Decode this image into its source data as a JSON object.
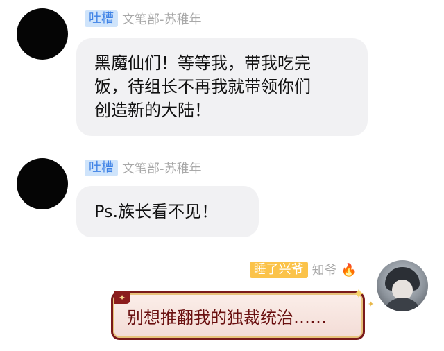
{
  "messages": [
    {
      "tag": "吐槽",
      "sender": "文笔部-苏稚年",
      "lines": [
        "黑魔仙们！等等我，带我吃完",
        "饭，待组长不再我就带领你们",
        "创造新的大陆！"
      ]
    },
    {
      "tag": "吐槽",
      "sender": "文笔部-苏稚年",
      "lines": [
        "Ps.族长看不见！"
      ]
    },
    {
      "tag": "睡了兴爷",
      "sender": "知爷",
      "badge_icon": "fire-icon",
      "lines": [
        "别想推翻我的独裁统治……"
      ]
    }
  ],
  "colors": {
    "tag_blue_bg": "#cfe4fb",
    "tag_blue_text": "#3e82e6",
    "tag_gold_bg": "#fbc34a",
    "bubble_bg": "#f1f1f3",
    "fancy_border": "#7a1a1a"
  }
}
